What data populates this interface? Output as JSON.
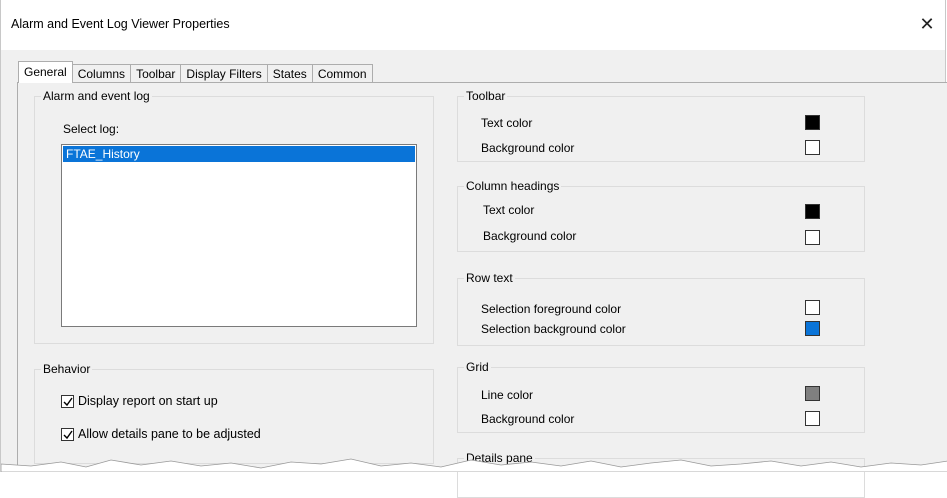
{
  "window": {
    "title": "Alarm and Event Log Viewer Properties",
    "close_glyph": "✕"
  },
  "tabs": [
    {
      "label": "General",
      "active": true
    },
    {
      "label": "Columns",
      "active": false
    },
    {
      "label": "Toolbar",
      "active": false
    },
    {
      "label": "Display Filters",
      "active": false
    },
    {
      "label": "States",
      "active": false
    },
    {
      "label": "Common",
      "active": false
    }
  ],
  "alarm_log": {
    "group_label": "Alarm and event log",
    "select_label": "Select log:",
    "items": [
      "FTAE_History"
    ],
    "selected": "FTAE_History"
  },
  "behavior": {
    "group_label": "Behavior",
    "display_report": {
      "label": "Display report on start up",
      "checked": true
    },
    "allow_details": {
      "label": "Allow details pane to be adjusted",
      "checked": true
    }
  },
  "toolbar_group": {
    "group_label": "Toolbar",
    "text_color": {
      "label": "Text color",
      "color": "#000000"
    },
    "background_color": {
      "label": "Background color",
      "color": "#ffffff"
    }
  },
  "column_headings": {
    "group_label": "Column headings",
    "text_color": {
      "label": "Text color",
      "color": "#000000"
    },
    "background_color": {
      "label": "Background color",
      "color": "#ffffff"
    }
  },
  "row_text": {
    "group_label": "Row text",
    "selection_foreground": {
      "label": "Selection foreground color",
      "color": "#ffffff"
    },
    "selection_background": {
      "label": "Selection background color",
      "color": "#0a74d8"
    }
  },
  "grid": {
    "group_label": "Grid",
    "line_color": {
      "label": "Line color",
      "color": "#7f7f7f"
    },
    "background_color": {
      "label": "Background color",
      "color": "#ffffff"
    }
  },
  "details_pane": {
    "group_label": "Details pane"
  }
}
